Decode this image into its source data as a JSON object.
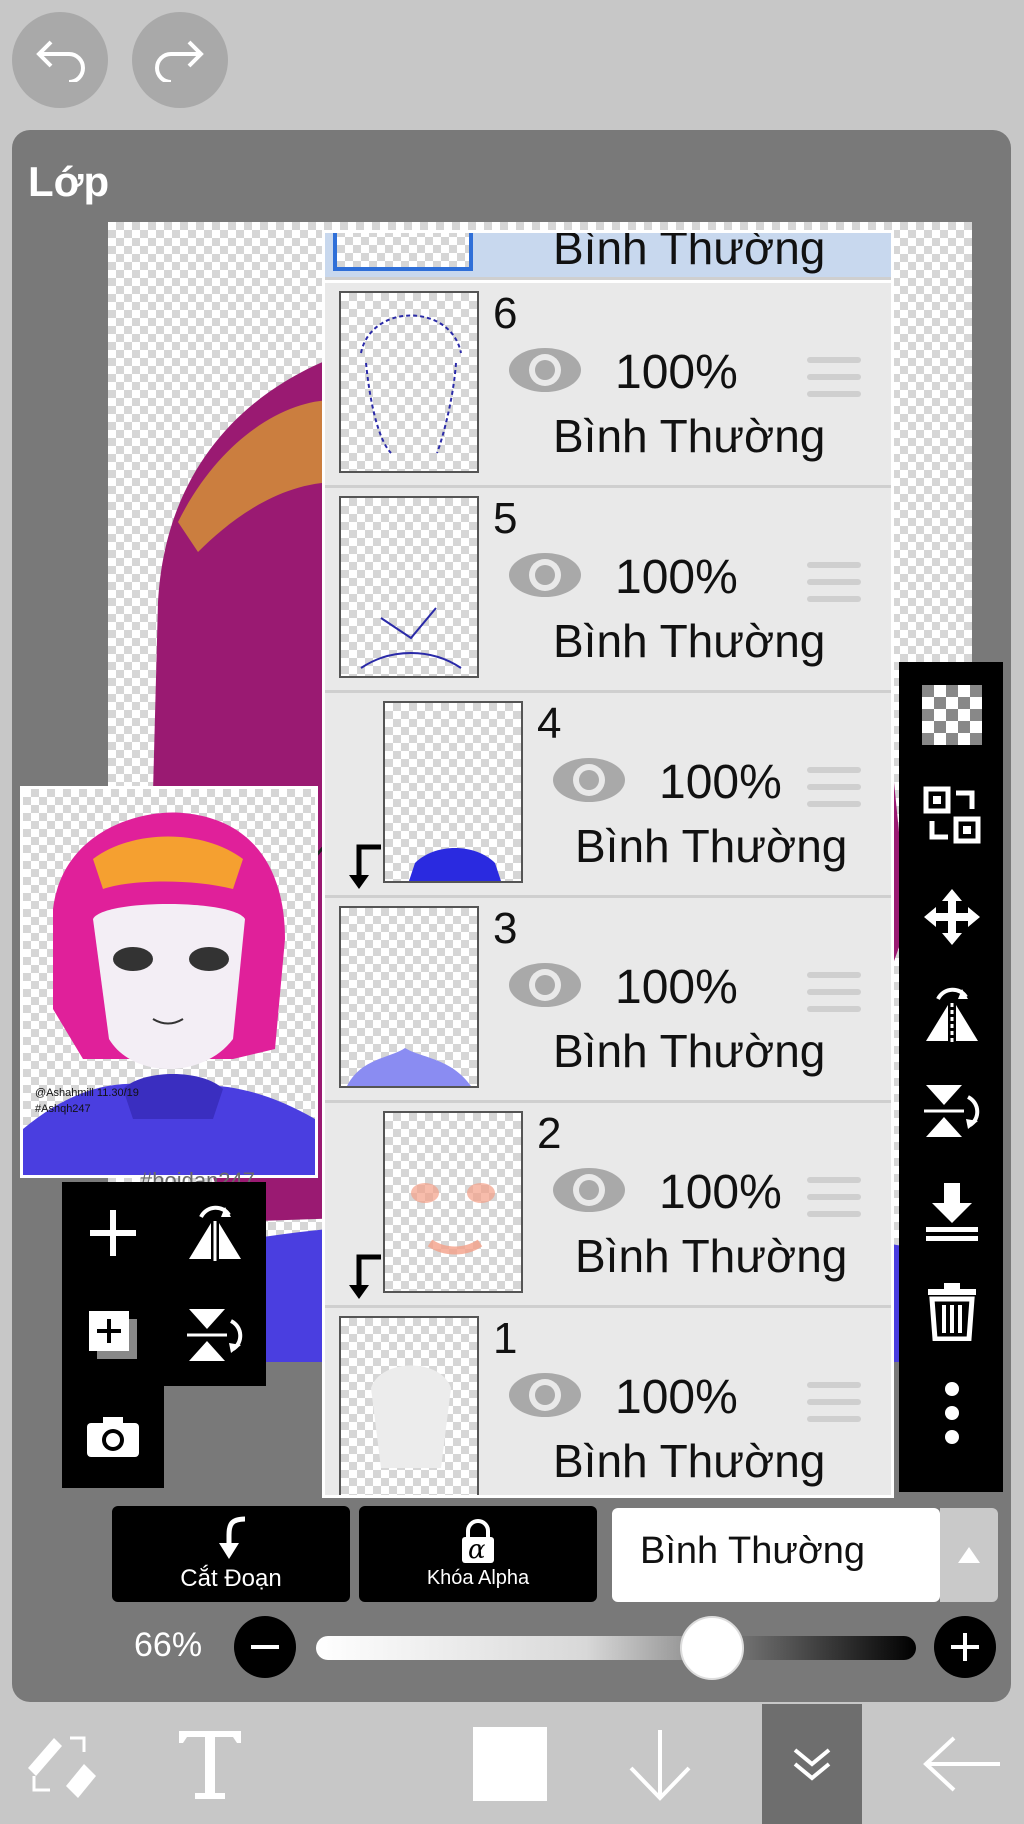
{
  "top_bar": {
    "undo_icon": "undo-icon",
    "redo_icon": "redo-icon"
  },
  "panel": {
    "title": "Lớp"
  },
  "layers": [
    {
      "number": "",
      "opacity": "",
      "blend": "Bình Thường",
      "selected": true
    },
    {
      "number": "6",
      "opacity": "100%",
      "blend": "Bình Thường",
      "clipped": false
    },
    {
      "number": "5",
      "opacity": "100%",
      "blend": "Bình Thường",
      "clipped": false
    },
    {
      "number": "4",
      "opacity": "100%",
      "blend": "Bình Thường",
      "clipped": true
    },
    {
      "number": "3",
      "opacity": "100%",
      "blend": "Bình Thường",
      "clipped": false
    },
    {
      "number": "2",
      "opacity": "100%",
      "blend": "Bình Thường",
      "clipped": true
    },
    {
      "number": "1",
      "opacity": "100%",
      "blend": "Bình Thường",
      "clipped": false
    }
  ],
  "preview": {
    "signature_lines": [
      "@Ashahmill 11.30/19",
      "#Ashqh247"
    ],
    "canvas_watermark": "#hoidan247"
  },
  "bottom_controls": {
    "clip_label": "Cắt Đoạn",
    "alpha_lock_label": "Khóa Alpha",
    "alpha_symbol": "α",
    "blend_mode": "Bình Thường",
    "opacity_label": "66%",
    "opacity_value": 0.66
  },
  "colors": {
    "panel": "#797979",
    "background": "#c7c7c7",
    "hair": "#e0209a",
    "sweater": "#4a3ee0",
    "layer_blue": "#8a8cf2",
    "selected_row": "#c8d8ee"
  }
}
